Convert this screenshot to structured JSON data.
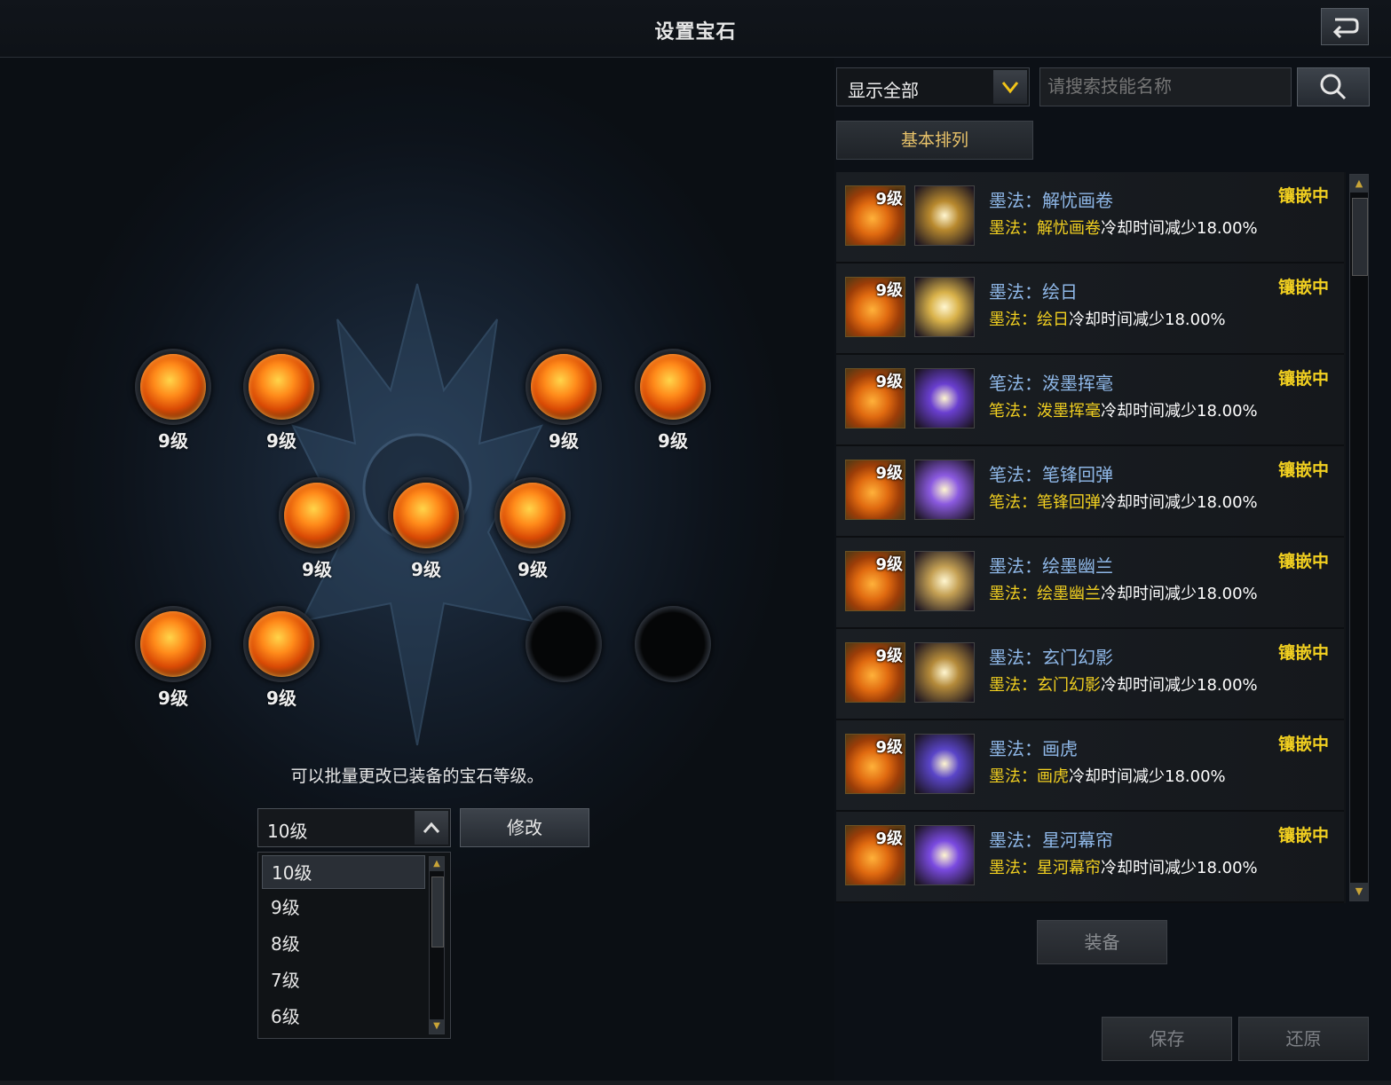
{
  "header": {
    "title": "设置宝石"
  },
  "gem_slots": [
    {
      "level": "9级",
      "filled": true
    },
    {
      "level": "9级",
      "filled": true
    },
    {
      "level": "9级",
      "filled": true
    },
    {
      "level": "9级",
      "filled": true
    },
    {
      "level": "9级",
      "filled": true
    },
    {
      "level": "9级",
      "filled": true
    },
    {
      "level": "9级",
      "filled": true
    },
    {
      "level": "9级",
      "filled": true
    },
    {
      "level": "9级",
      "filled": true
    },
    {
      "level": "",
      "filled": false
    },
    {
      "level": "",
      "filled": false
    }
  ],
  "batch": {
    "hint": "可以批量更改已装备的宝石等级。",
    "selected_level": "10级",
    "modify_label": "修改",
    "options": [
      "10级",
      "9级",
      "8级",
      "7级",
      "6级"
    ]
  },
  "filter": {
    "selected": "显示全部"
  },
  "search": {
    "placeholder": "请搜索技能名称"
  },
  "sort": {
    "label": "基本排列"
  },
  "skills": [
    {
      "gem_level": "9级",
      "prefix": "墨法：",
      "name": "解忧画卷",
      "effect": "冷却时间减少18.00%",
      "status": "镶嵌中",
      "icon": "ink-scroll-icon",
      "icon_color": "#b8892e"
    },
    {
      "gem_level": "9级",
      "prefix": "墨法：",
      "name": "绘日",
      "effect": "冷却时间减少18.00%",
      "status": "镶嵌中",
      "icon": "sun-burst-icon",
      "icon_color": "#d9b24a"
    },
    {
      "gem_level": "9级",
      "prefix": "笔法：",
      "name": "泼墨挥毫",
      "effect": "冷却时间减少18.00%",
      "status": "镶嵌中",
      "icon": "ink-splash-icon",
      "icon_color": "#6a3fd0"
    },
    {
      "gem_level": "9级",
      "prefix": "笔法：",
      "name": "笔锋回弹",
      "effect": "冷却时间减少18.00%",
      "status": "镶嵌中",
      "icon": "brush-rebound-icon",
      "icon_color": "#8b5ae0"
    },
    {
      "gem_level": "9级",
      "prefix": "墨法：",
      "name": "绘墨幽兰",
      "effect": "冷却时间减少18.00%",
      "status": "镶嵌中",
      "icon": "orchid-icon",
      "icon_color": "#c4a054"
    },
    {
      "gem_level": "9级",
      "prefix": "墨法：",
      "name": "玄门幻影",
      "effect": "冷却时间减少18.00%",
      "status": "镶嵌中",
      "icon": "phantom-icon",
      "icon_color": "#b48a3a"
    },
    {
      "gem_level": "9级",
      "prefix": "墨法：",
      "name": "画虎",
      "effect": "冷却时间减少18.00%",
      "status": "镶嵌中",
      "icon": "tiger-icon",
      "icon_color": "#5a45c8"
    },
    {
      "gem_level": "9级",
      "prefix": "墨法：",
      "name": "星河幕帘",
      "effect": "冷却时间减少18.00%",
      "status": "镶嵌中",
      "icon": "star-curtain-icon",
      "icon_color": "#7a4ae0"
    }
  ],
  "buttons": {
    "equip": "装备",
    "save": "保存",
    "restore": "还原"
  },
  "colors": {
    "accent_gold": "#f2d020",
    "skill_name_blue": "#8fb8e8",
    "sort_text": "#e9c36a"
  }
}
